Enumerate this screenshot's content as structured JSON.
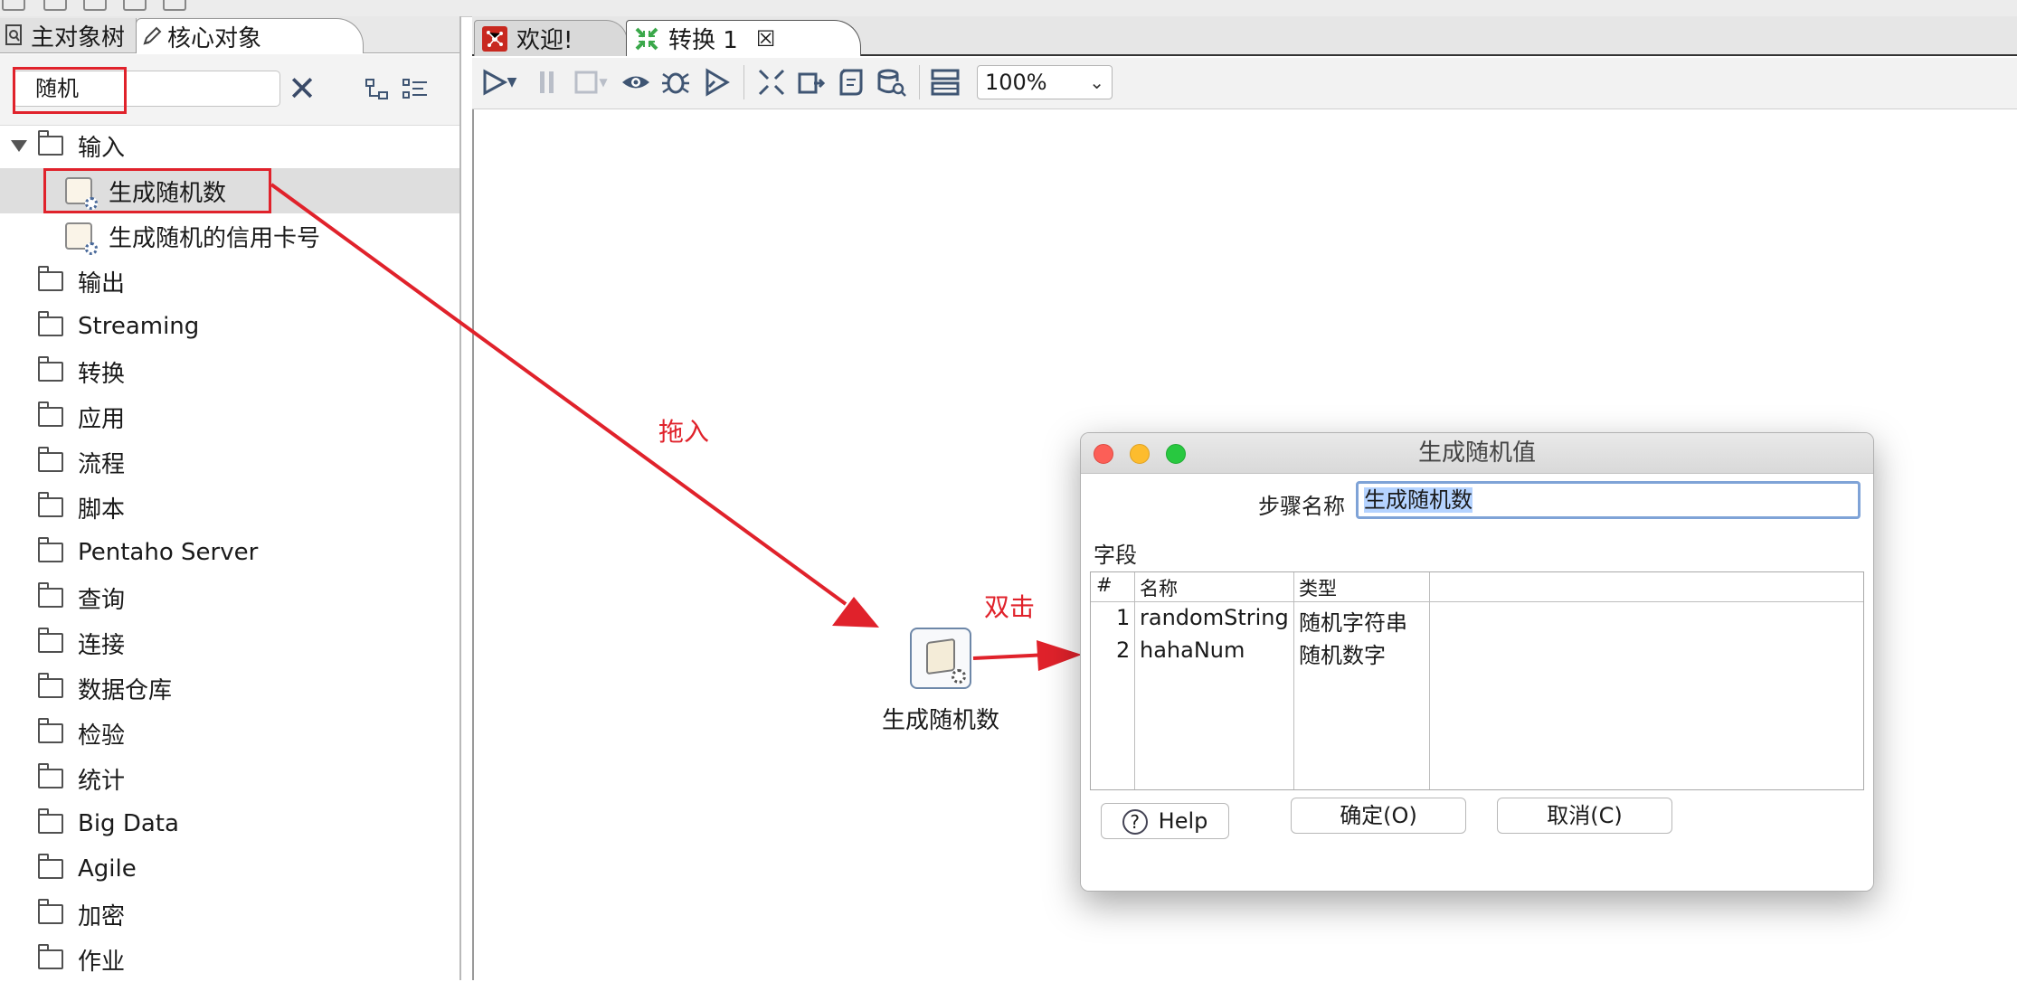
{
  "left_panel": {
    "tabs": [
      {
        "label": "主对象树"
      },
      {
        "label": "核心对象"
      }
    ],
    "search": {
      "value": "随机"
    },
    "tree": {
      "input_folder": "输入",
      "input_children": [
        "生成随机数",
        "生成随机的信用卡号"
      ],
      "folders": [
        "输出",
        "Streaming",
        "转换",
        "应用",
        "流程",
        "脚本",
        "Pentaho Server",
        "查询",
        "连接",
        "数据仓库",
        "检验",
        "统计",
        "Big Data",
        "Agile",
        "加密",
        "作业"
      ]
    }
  },
  "editor": {
    "tabs": [
      {
        "label": "欢迎!"
      },
      {
        "label": "转换 1"
      }
    ],
    "zoom": "100%",
    "step": {
      "label": "生成随机数"
    },
    "annotations": {
      "drag": "拖入",
      "double_click": "双击"
    }
  },
  "dialog": {
    "title": "生成随机值",
    "step_name_label": "步骤名称",
    "step_name_value": "生成随机数",
    "fields_label": "字段",
    "columns": [
      "#",
      "名称",
      "类型"
    ],
    "rows": [
      {
        "num": "1",
        "name": "randomString",
        "type": "随机字符串"
      },
      {
        "num": "2",
        "name": "hahaNum",
        "type": "随机数字"
      }
    ],
    "help_label": "Help",
    "ok_label": "确定(O)",
    "cancel_label": "取消(C)"
  },
  "colors": {
    "annotation_red": "#e0222b",
    "traffic_red": "#fc5f57",
    "traffic_yellow": "#fdbc2e",
    "traffic_green": "#28c840",
    "selection_blue": "#b5d3ff",
    "icon_blue": "#3f5573"
  }
}
